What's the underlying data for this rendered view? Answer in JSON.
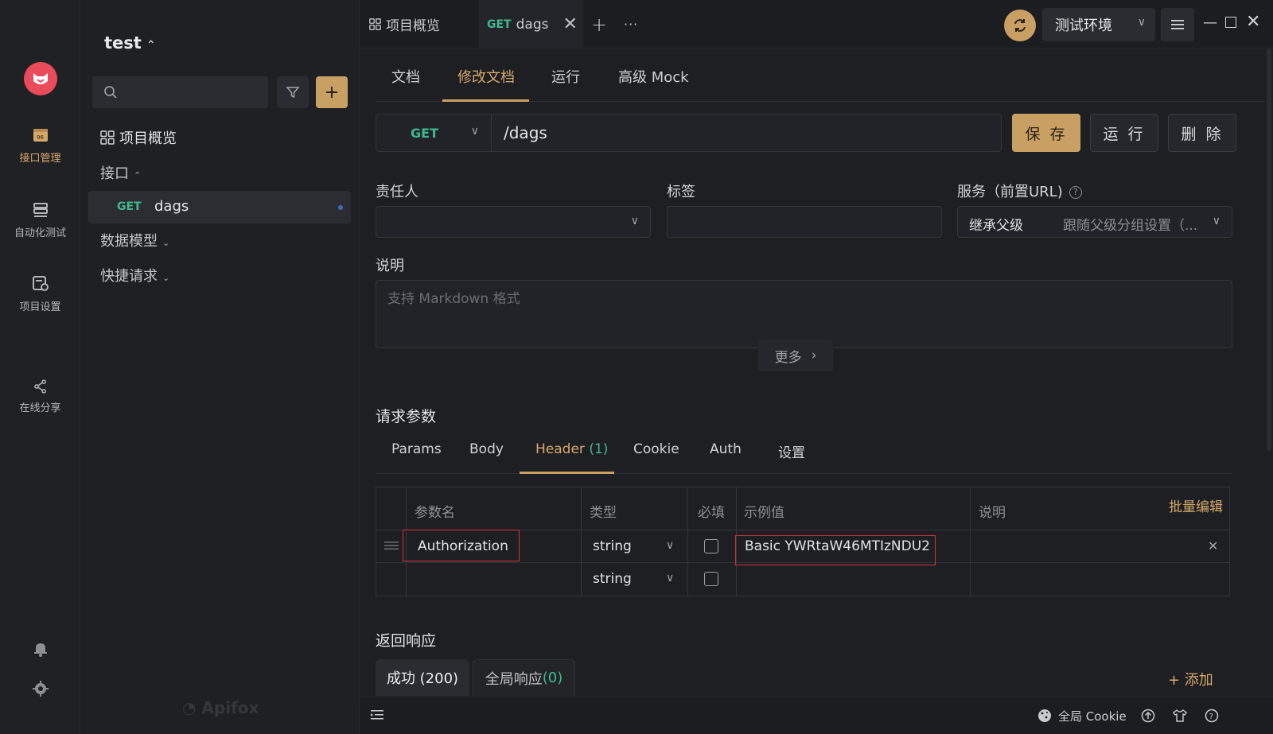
{
  "sidebar_rail": {
    "items": [
      {
        "label": "接口管理",
        "icon": "api-management-icon",
        "active": true
      },
      {
        "label": "自动化测试",
        "icon": "automation-test-icon",
        "active": false
      },
      {
        "label": "项目设置",
        "icon": "project-settings-icon",
        "active": false
      },
      {
        "label": "在线分享",
        "icon": "share-icon",
        "active": false
      }
    ],
    "bottom_icons": [
      "bell-icon",
      "gear-icon"
    ]
  },
  "sidebar": {
    "project_name": "test",
    "search_placeholder": "",
    "tree": {
      "overview": "项目概览",
      "interfaces": "接口",
      "active_item": {
        "method": "GET",
        "name": "dags"
      },
      "data_models": "数据模型",
      "quick_requests": "快捷请求"
    },
    "brand": "Apifox"
  },
  "topbar": {
    "tabs": [
      {
        "label": "项目概览"
      },
      {
        "method": "GET",
        "label": "dags"
      }
    ],
    "add_tab": "+",
    "more": "···",
    "environment": "测试环境"
  },
  "doc_tabs": [
    "文档",
    "修改文档",
    "运行",
    "高级 Mock"
  ],
  "request": {
    "method": "GET",
    "path": "/dags",
    "save_label": "保 存",
    "run_label": "运 行",
    "delete_label": "删 除"
  },
  "fields": {
    "owner_label": "责任人",
    "tags_label": "标签",
    "service_label": "服务（前置URL)",
    "service_value": "继承父级",
    "service_hint": "跟随父级分组设置（...",
    "description_label": "说明",
    "description_placeholder": "支持 Markdown 格式",
    "more_label": "更多"
  },
  "params": {
    "title": "请求参数",
    "tabs": [
      {
        "label": "Params"
      },
      {
        "label": "Body"
      },
      {
        "label": "Header",
        "count": "(1)"
      },
      {
        "label": "Cookie"
      },
      {
        "label": "Auth"
      },
      {
        "label": "设置"
      }
    ],
    "active_tab": "Header",
    "columns": [
      "参数名",
      "类型",
      "必填",
      "示例值",
      "说明"
    ],
    "batch_edit": "批量编辑",
    "rows": [
      {
        "name": "Authorization",
        "type": "string",
        "required": false,
        "example": "Basic YWRtaW46MTIzNDU2",
        "desc": ""
      },
      {
        "name": "",
        "type": "string",
        "required": false,
        "example": "",
        "desc": ""
      }
    ]
  },
  "response": {
    "title": "返回响应",
    "tabs": [
      {
        "label": "成功 (200)"
      },
      {
        "label": "全局响应",
        "count": "(0)"
      }
    ],
    "add_label": "+ 添加"
  },
  "statusbar": {
    "cookie_label": "全局 Cookie"
  },
  "colors": {
    "accent": "#c9a063",
    "get_method": "#3dba8c",
    "highlight_box": "#d0313b"
  }
}
